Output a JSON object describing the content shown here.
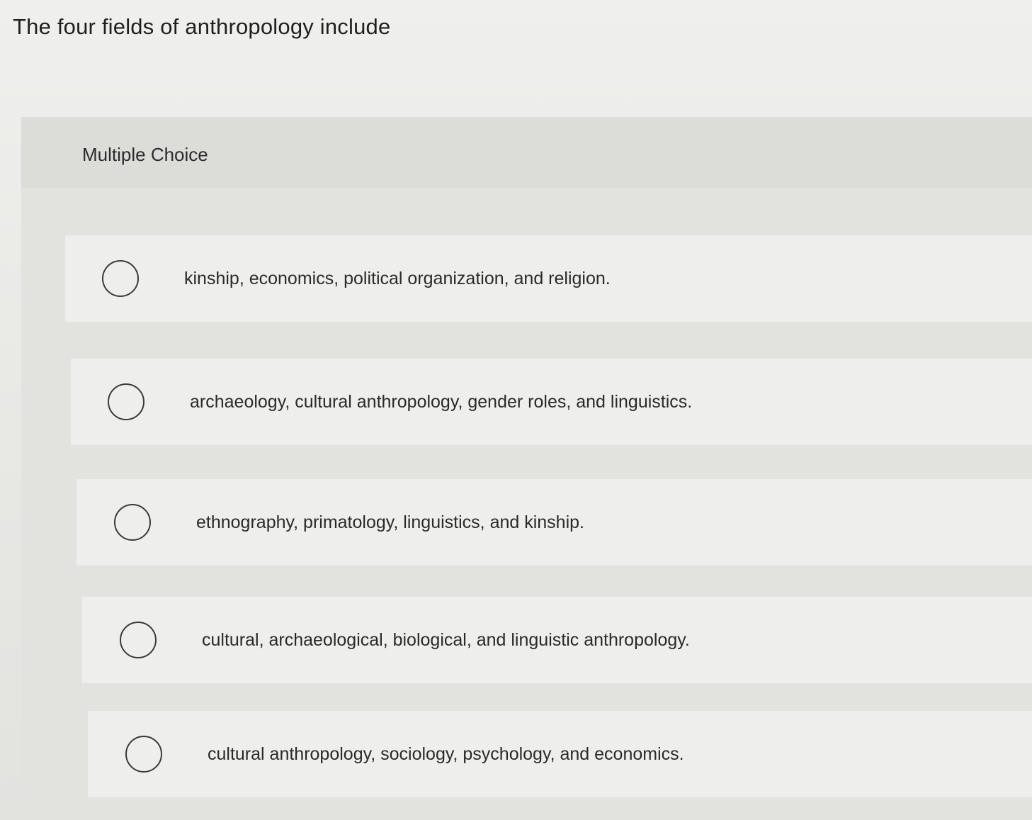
{
  "question": {
    "text": "The four fields of anthropology include"
  },
  "panel": {
    "type_label": "Multiple Choice"
  },
  "choices": [
    {
      "label": "kinship, economics, political organization, and religion.",
      "selected": false
    },
    {
      "label": "archaeology, cultural anthropology, gender roles, and linguistics.",
      "selected": false
    },
    {
      "label": "ethnography, primatology, linguistics, and kinship.",
      "selected": false
    },
    {
      "label": "cultural, archaeological, biological, and linguistic anthropology.",
      "selected": false
    },
    {
      "label": "cultural anthropology, sociology, psychology, and economics.",
      "selected": false
    }
  ]
}
